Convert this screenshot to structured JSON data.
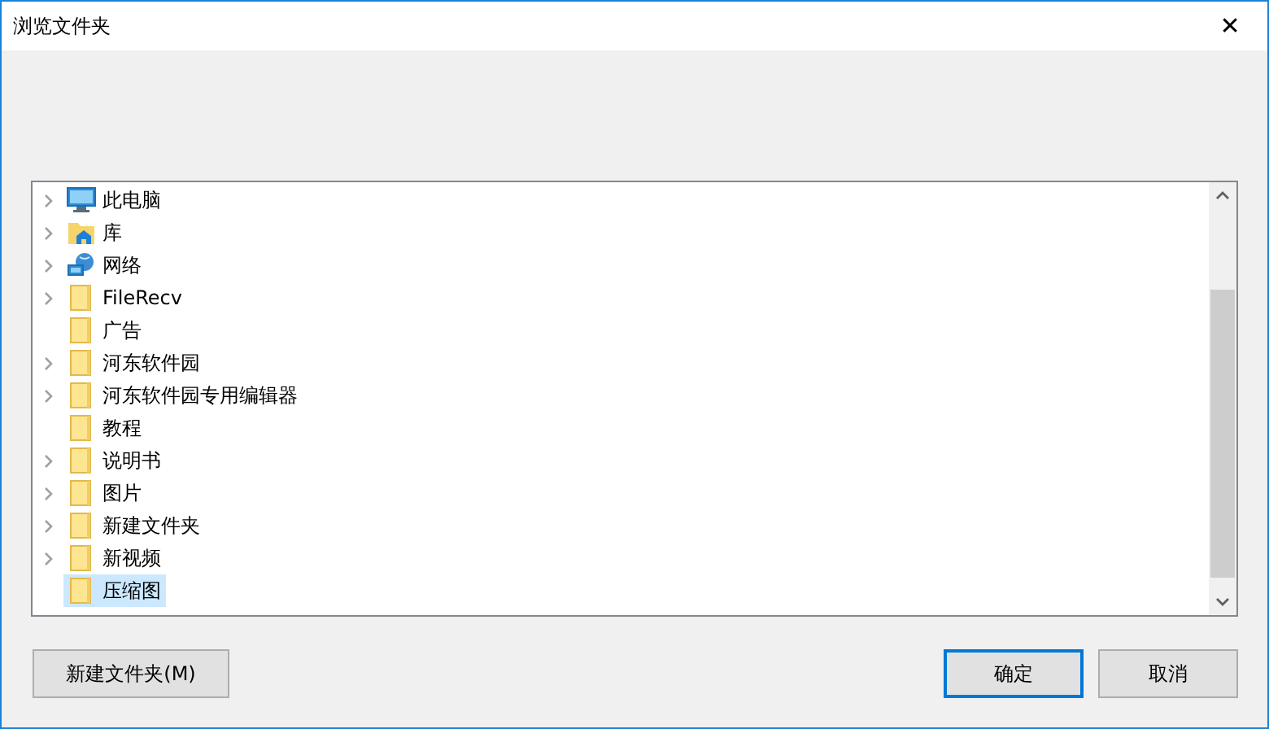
{
  "window": {
    "title": "浏览文件夹",
    "close": "✕"
  },
  "tree": {
    "items": [
      {
        "label": "此电脑",
        "kind": "computer",
        "expandable": true,
        "selected": false
      },
      {
        "label": "库",
        "kind": "library",
        "expandable": true,
        "selected": false
      },
      {
        "label": "网络",
        "kind": "network",
        "expandable": true,
        "selected": false
      },
      {
        "label": "FileRecv",
        "kind": "folder",
        "expandable": true,
        "selected": false
      },
      {
        "label": "广告",
        "kind": "folder",
        "expandable": false,
        "selected": false
      },
      {
        "label": "河东软件园",
        "kind": "folder",
        "expandable": true,
        "selected": false
      },
      {
        "label": "河东软件园专用编辑器",
        "kind": "folder",
        "expandable": true,
        "selected": false
      },
      {
        "label": "教程",
        "kind": "folder",
        "expandable": false,
        "selected": false
      },
      {
        "label": "说明书",
        "kind": "folder",
        "expandable": true,
        "selected": false
      },
      {
        "label": "图片",
        "kind": "folder",
        "expandable": true,
        "selected": false
      },
      {
        "label": "新建文件夹",
        "kind": "folder",
        "expandable": true,
        "selected": false
      },
      {
        "label": "新视频",
        "kind": "folder",
        "expandable": true,
        "selected": false
      },
      {
        "label": "压缩图",
        "kind": "folder",
        "expandable": false,
        "selected": true
      }
    ]
  },
  "buttons": [
    {
      "label": "新建文件夹(M)",
      "default": false
    },
    {
      "label": "确定",
      "default": true
    },
    {
      "label": "取消",
      "default": false
    }
  ]
}
